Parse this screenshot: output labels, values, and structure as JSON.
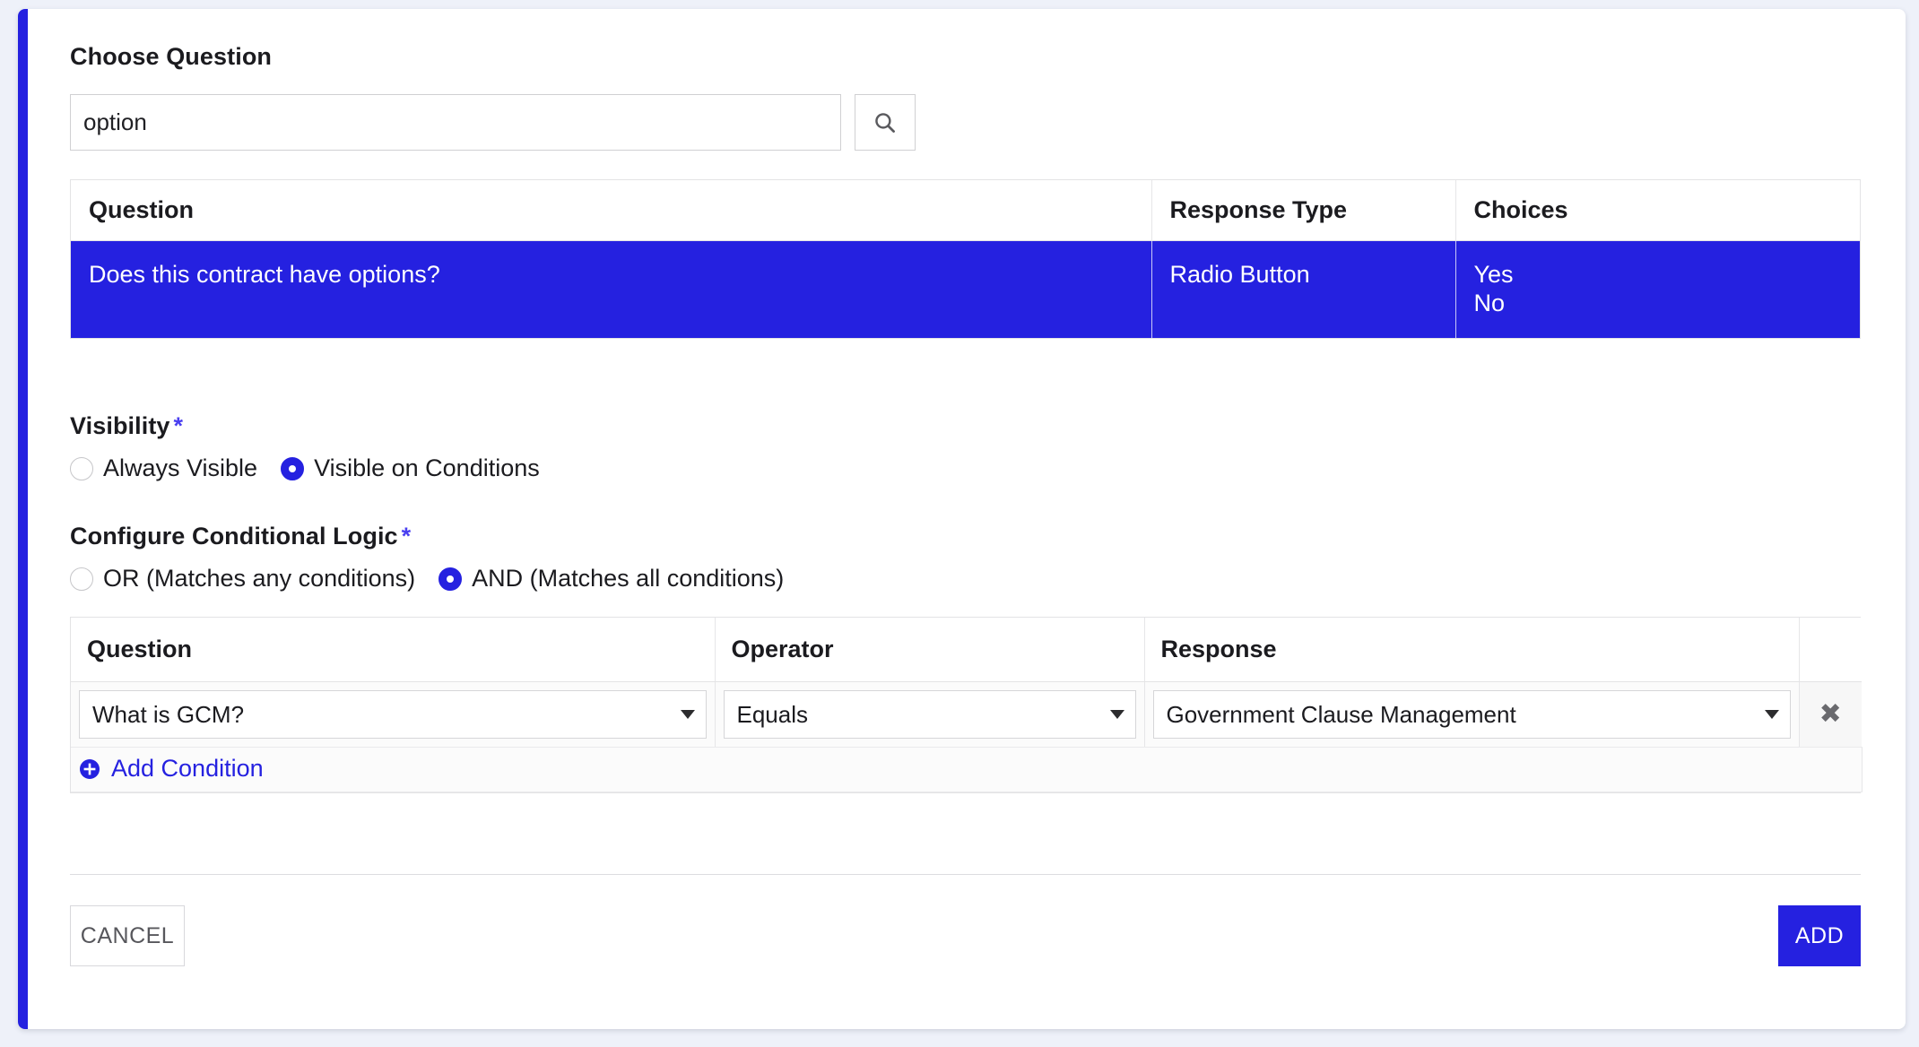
{
  "theme": {
    "accent": "#2521E0",
    "page_bg": "#EEF1F9",
    "card_bg": "#FFFFFF",
    "border": "#E3E3E5",
    "text": "#1B1B1F",
    "muted_text": "#57575C"
  },
  "choose_question": {
    "label": "Choose Question",
    "search": {
      "value": "option",
      "placeholder": "",
      "icon": "search-icon",
      "button_title": "Search"
    },
    "table": {
      "columns": [
        "Question",
        "Response Type",
        "Choices"
      ],
      "rows": [
        {
          "question": "Does this contract have options?",
          "response_type": "Radio Button",
          "choices": [
            "Yes",
            "No"
          ],
          "selected": true
        }
      ]
    }
  },
  "visibility": {
    "label": "Visibility",
    "required_marker": "*",
    "options": [
      {
        "label": "Always Visible",
        "checked": false
      },
      {
        "label": "Visible on Conditions",
        "checked": true
      }
    ]
  },
  "conditional_logic": {
    "label": "Configure Conditional Logic",
    "required_marker": "*",
    "options": [
      {
        "label": "OR (Matches any conditions)",
        "checked": false
      },
      {
        "label": "AND (Matches all conditions)",
        "checked": true
      }
    ],
    "table": {
      "columns": [
        "Question",
        "Operator",
        "Response",
        ""
      ],
      "rows": [
        {
          "question": "What is GCM?",
          "operator": "Equals",
          "response": "Government Clause Management",
          "delete_glyph": "✖",
          "delete_title": "Remove condition"
        }
      ]
    },
    "add_condition": {
      "label": "Add Condition",
      "icon": "plus-circle-icon"
    }
  },
  "footer": {
    "cancel_label": "CANCEL",
    "add_label": "ADD"
  }
}
